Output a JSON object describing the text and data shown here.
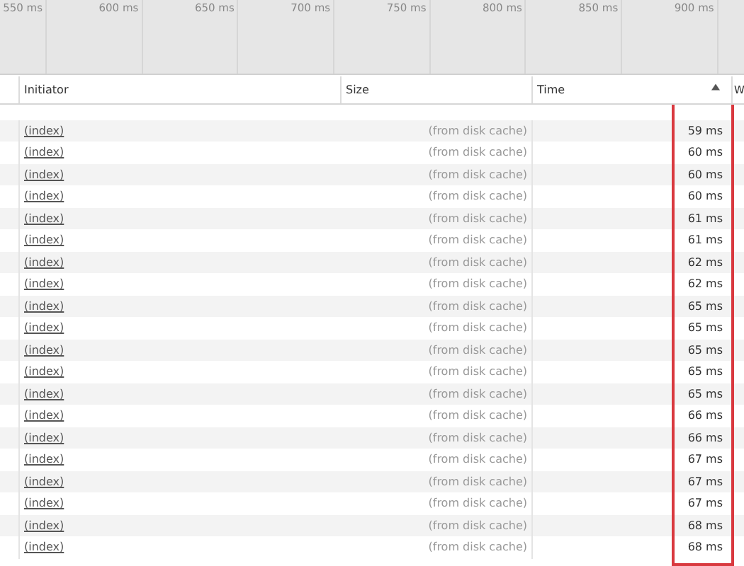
{
  "timeline": {
    "ticks": [
      "550 ms",
      "600 ms",
      "650 ms",
      "700 ms",
      "750 ms",
      "800 ms",
      "850 ms",
      "900 ms"
    ]
  },
  "table": {
    "columns": [
      {
        "label": "Initiator",
        "sorted": false,
        "highlighted": false
      },
      {
        "label": "Size",
        "sorted": false,
        "highlighted": false
      },
      {
        "label": "Time",
        "sorted": true,
        "highlighted": true
      },
      {
        "label": "W",
        "sorted": false,
        "highlighted": false
      }
    ],
    "rows": [
      {
        "initiator": "(index)",
        "size": "(from disk cache)",
        "time": "59 ms"
      },
      {
        "initiator": "(index)",
        "size": "(from disk cache)",
        "time": "60 ms"
      },
      {
        "initiator": "(index)",
        "size": "(from disk cache)",
        "time": "60 ms"
      },
      {
        "initiator": "(index)",
        "size": "(from disk cache)",
        "time": "60 ms"
      },
      {
        "initiator": "(index)",
        "size": "(from disk cache)",
        "time": "61 ms"
      },
      {
        "initiator": "(index)",
        "size": "(from disk cache)",
        "time": "61 ms"
      },
      {
        "initiator": "(index)",
        "size": "(from disk cache)",
        "time": "62 ms"
      },
      {
        "initiator": "(index)",
        "size": "(from disk cache)",
        "time": "62 ms"
      },
      {
        "initiator": "(index)",
        "size": "(from disk cache)",
        "time": "65 ms"
      },
      {
        "initiator": "(index)",
        "size": "(from disk cache)",
        "time": "65 ms"
      },
      {
        "initiator": "(index)",
        "size": "(from disk cache)",
        "time": "65 ms"
      },
      {
        "initiator": "(index)",
        "size": "(from disk cache)",
        "time": "65 ms"
      },
      {
        "initiator": "(index)",
        "size": "(from disk cache)",
        "time": "65 ms"
      },
      {
        "initiator": "(index)",
        "size": "(from disk cache)",
        "time": "66 ms"
      },
      {
        "initiator": "(index)",
        "size": "(from disk cache)",
        "time": "66 ms"
      },
      {
        "initiator": "(index)",
        "size": "(from disk cache)",
        "time": "67 ms"
      },
      {
        "initiator": "(index)",
        "size": "(from disk cache)",
        "time": "67 ms"
      },
      {
        "initiator": "(index)",
        "size": "(from disk cache)",
        "time": "67 ms"
      },
      {
        "initiator": "(index)",
        "size": "(from disk cache)",
        "time": "68 ms"
      },
      {
        "initiator": "(index)",
        "size": "(from disk cache)",
        "time": "68 ms"
      }
    ]
  }
}
